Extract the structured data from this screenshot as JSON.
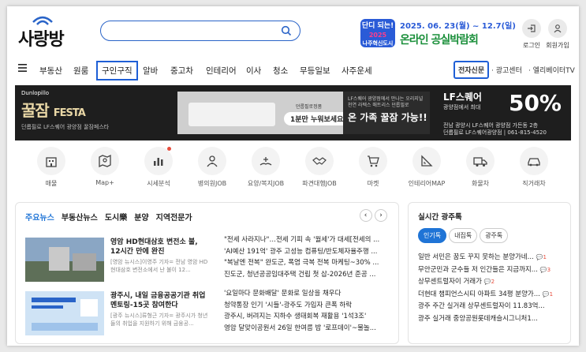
{
  "header": {
    "logo_text": "사랑방",
    "search_placeholder": "",
    "festival": {
      "badge_line1": "단디 되는!",
      "badge_year": "2025",
      "badge_line2": "나주혁신도시",
      "dates": "2025. 06. 23(월) ~ 12.7(일)",
      "title": "온라인 공실박람회"
    },
    "login_label": "로그인",
    "signup_label": "회원가입"
  },
  "nav": {
    "items": [
      "부동산",
      "원룸",
      "구인구직",
      "알바",
      "중고차",
      "인테리어",
      "이사",
      "청소",
      "무등일보",
      "사주운세"
    ],
    "right_items": [
      "전자신문",
      "광고센터",
      "엘리베이터TV"
    ]
  },
  "ad": {
    "brand": "Dunlopillo",
    "title": "꿀잠",
    "title_suffix": "FESTA",
    "sub": "던롭필로 LF스퀘어 광양점 꿀잠페스타",
    "pill_top": "던롭필로정품",
    "pill": "1분만 누워보세요.",
    "mid_small": "LF스퀘어 광양점에서 만나는 오리지널 천연 라텍스 매트리스 던롭필로",
    "mid_big": "온 가족 꿀잠 가능!!",
    "right_title": "LF스퀘어",
    "right_sub": "광양점에서 최대",
    "percent": "50%",
    "addr1": "전남 광양시 LF스퀘어 광양점 가든동 2층",
    "addr2": "던롭필로 LF스퀘어광양점 | 061-815-4520"
  },
  "icons": [
    {
      "label": "매물",
      "icon": "building-icon"
    },
    {
      "label": "Map+",
      "icon": "map-icon"
    },
    {
      "label": "시세분석",
      "icon": "chart-icon"
    },
    {
      "label": "병의원JOB",
      "icon": "doctor-icon"
    },
    {
      "label": "요양/복지JOB",
      "icon": "care-icon"
    },
    {
      "label": "파견대행JOB",
      "icon": "handshake-icon"
    },
    {
      "label": "마켓",
      "icon": "cart-icon"
    },
    {
      "label": "인테리어MAP",
      "icon": "ruler-icon"
    },
    {
      "label": "화물차",
      "icon": "truck-icon"
    },
    {
      "label": "직거래차",
      "icon": "car-icon"
    }
  ],
  "news": {
    "tabs": [
      "주요뉴스",
      "부동산뉴스",
      "도시樂",
      "분양",
      "지역전문가"
    ],
    "cards": [
      {
        "title": "영암 HD현대삼호 변전소 불, 12시간 만에 완진",
        "desc": "[영암 뉴시스]이영주 기자= 전남 영암 HD현대삼호 변전소에서 난 불이 12..."
      },
      {
        "title": "광주시, 내일 금융공공기관 취업 멘토링-15곳 참여한다",
        "desc": "[광주 뉴시스]류형근 기자= 광주시가 청년들의 취업을 지원하기 위해 금융공..."
      }
    ],
    "list_a": [
      "\"전세 사라지나\"…전세 기피 속 '월세'가 대세[전세의 ...",
      "'AI예산 191억' 광주 고성능 컴퓨팅/반도체자율주행 ...",
      "\"복날엔 전복\" 완도군, 폭염 극복 전복 마케팅~30% ...",
      "진도군, 청년공공임대주택 건립 첫 삽-2026년 준공 ..."
    ],
    "list_b": [
      "'요일마다 문화배달' 문화로 일상을 채우다",
      "청약통장 인기 '시들'-광주도 가입자 큰폭 하락",
      "광주시, 버려지는 지하수 생태회복 재활용 '1석3조'",
      "영암 달맞이공원서 26일 한여름 밤 '로프데이'~물놀..."
    ]
  },
  "trending": {
    "title": "실시간 광주톡",
    "chips": [
      "인기톡",
      "내집톡",
      "광주톡"
    ],
    "items": [
      {
        "text": "일반 서민은 꿈도 꾸지 못하는 분양가네...",
        "count": "1"
      },
      {
        "text": "무안군민과 군수들 저 인간들은 지금까지...",
        "count": "3"
      },
      {
        "text": "상무센트럴자이 거래가",
        "count": "2"
      },
      {
        "text": "더현대 챔피언스시티 아파트 34평 분양가...",
        "count": "1"
      },
      {
        "text": "광주 주간 실거래 상무센트럴자이 11.83억...",
        "count": ""
      },
      {
        "text": "광주 실거래 중앙공원롯데캐슬시그니처1...",
        "count": ""
      }
    ]
  }
}
